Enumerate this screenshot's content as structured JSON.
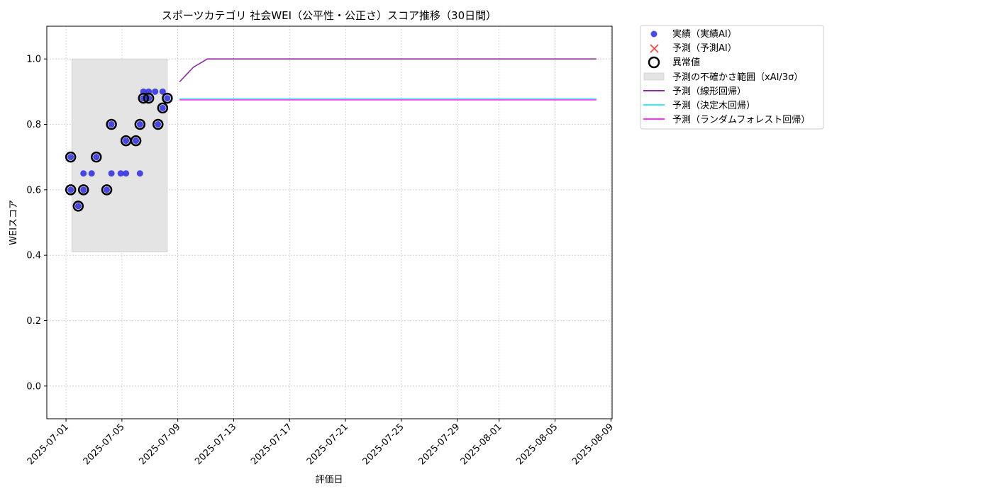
{
  "chart_data": {
    "type": "scatter",
    "title": "スポーツカテゴリ 社会WEI（公平性・公正さ）スコア推移（30日間）",
    "xlabel": "評価日",
    "ylabel": "WEIスコア",
    "xlim": [
      "2025-06-29T15:00",
      "2025-08-09T02:00"
    ],
    "ylim": [
      -0.1,
      1.1
    ],
    "x_ticks": [
      "2025-07-01",
      "2025-07-05",
      "2025-07-09",
      "2025-07-13",
      "2025-07-17",
      "2025-07-21",
      "2025-07-25",
      "2025-07-29",
      "2025-08-01",
      "2025-08-05",
      "2025-08-09"
    ],
    "y_ticks": [
      0.0,
      0.2,
      0.4,
      0.6,
      0.8,
      1.0
    ],
    "grid": true,
    "legend_position": "outside-top-right",
    "uncertainty_band": {
      "name": "予測の不確かさ範囲（xAI/3σ）",
      "x_start": "2025-07-01T10:00",
      "x_end": "2025-07-08T06:00",
      "y_low": 0.41,
      "y_high": 1.0,
      "color": "#e4e4e4"
    },
    "actual": {
      "name": "実績（実績AI）",
      "color": "#2a2ae6",
      "points": [
        {
          "x": "2025-07-01T08:00",
          "y": 0.7
        },
        {
          "x": "2025-07-01T08:00",
          "y": 0.6
        },
        {
          "x": "2025-07-01T21:00",
          "y": 0.55
        },
        {
          "x": "2025-07-02T06:00",
          "y": 0.6
        },
        {
          "x": "2025-07-02T06:00",
          "y": 0.65
        },
        {
          "x": "2025-07-02T20:00",
          "y": 0.65
        },
        {
          "x": "2025-07-03T04:00",
          "y": 0.7
        },
        {
          "x": "2025-07-03T22:00",
          "y": 0.6
        },
        {
          "x": "2025-07-04T06:00",
          "y": 0.8
        },
        {
          "x": "2025-07-04T06:00",
          "y": 0.65
        },
        {
          "x": "2025-07-04T22:00",
          "y": 0.65
        },
        {
          "x": "2025-07-05T07:00",
          "y": 0.65
        },
        {
          "x": "2025-07-05T07:00",
          "y": 0.75
        },
        {
          "x": "2025-07-06T00:00",
          "y": 0.75
        },
        {
          "x": "2025-07-06T07:00",
          "y": 0.8
        },
        {
          "x": "2025-07-06T07:00",
          "y": 0.65
        },
        {
          "x": "2025-07-06T13:00",
          "y": 0.88
        },
        {
          "x": "2025-07-06T13:00",
          "y": 0.9
        },
        {
          "x": "2025-07-06T22:00",
          "y": 0.88
        },
        {
          "x": "2025-07-06T22:00",
          "y": 0.9
        },
        {
          "x": "2025-07-07T09:00",
          "y": 0.9
        },
        {
          "x": "2025-07-07T14:00",
          "y": 0.8
        },
        {
          "x": "2025-07-07T22:00",
          "y": 0.85
        },
        {
          "x": "2025-07-07T22:00",
          "y": 0.9
        },
        {
          "x": "2025-07-08T06:00",
          "y": 0.88
        }
      ]
    },
    "predicted": {
      "name": "予測（予測AI）",
      "color": "#ff4040",
      "points": []
    },
    "anomalies": {
      "name": "異常値",
      "color": "#000000",
      "points": [
        {
          "x": "2025-07-01T08:00",
          "y": 0.7
        },
        {
          "x": "2025-07-01T08:00",
          "y": 0.6
        },
        {
          "x": "2025-07-01T21:00",
          "y": 0.55
        },
        {
          "x": "2025-07-02T06:00",
          "y": 0.6
        },
        {
          "x": "2025-07-03T04:00",
          "y": 0.7
        },
        {
          "x": "2025-07-03T22:00",
          "y": 0.6
        },
        {
          "x": "2025-07-04T06:00",
          "y": 0.8
        },
        {
          "x": "2025-07-05T07:00",
          "y": 0.75
        },
        {
          "x": "2025-07-06T00:00",
          "y": 0.75
        },
        {
          "x": "2025-07-06T07:00",
          "y": 0.8
        },
        {
          "x": "2025-07-06T13:00",
          "y": 0.88
        },
        {
          "x": "2025-07-06T22:00",
          "y": 0.88
        },
        {
          "x": "2025-07-07T14:00",
          "y": 0.8
        },
        {
          "x": "2025-07-07T22:00",
          "y": 0.85
        },
        {
          "x": "2025-07-08T06:00",
          "y": 0.88
        }
      ]
    },
    "series": [
      {
        "name": "予測（線形回帰）",
        "color": "#8a2b9a",
        "x": [
          "2025-07-09T03:00",
          "2025-07-10T03:00",
          "2025-07-11T03:00",
          "2025-07-12T03:00",
          "2025-08-07T23:00"
        ],
        "y": [
          0.93,
          0.975,
          1.0,
          1.0,
          1.0
        ]
      },
      {
        "name": "予測（決定木回帰）",
        "color": "#33eeff",
        "x": [
          "2025-07-09T03:00",
          "2025-08-07T23:00"
        ],
        "y": [
          0.878,
          0.878
        ]
      },
      {
        "name": "予測（ランダムフォレスト回帰）",
        "color": "#ff33ff",
        "x": [
          "2025-07-09T03:00",
          "2025-08-07T23:00"
        ],
        "y": [
          0.875,
          0.875
        ]
      }
    ]
  }
}
